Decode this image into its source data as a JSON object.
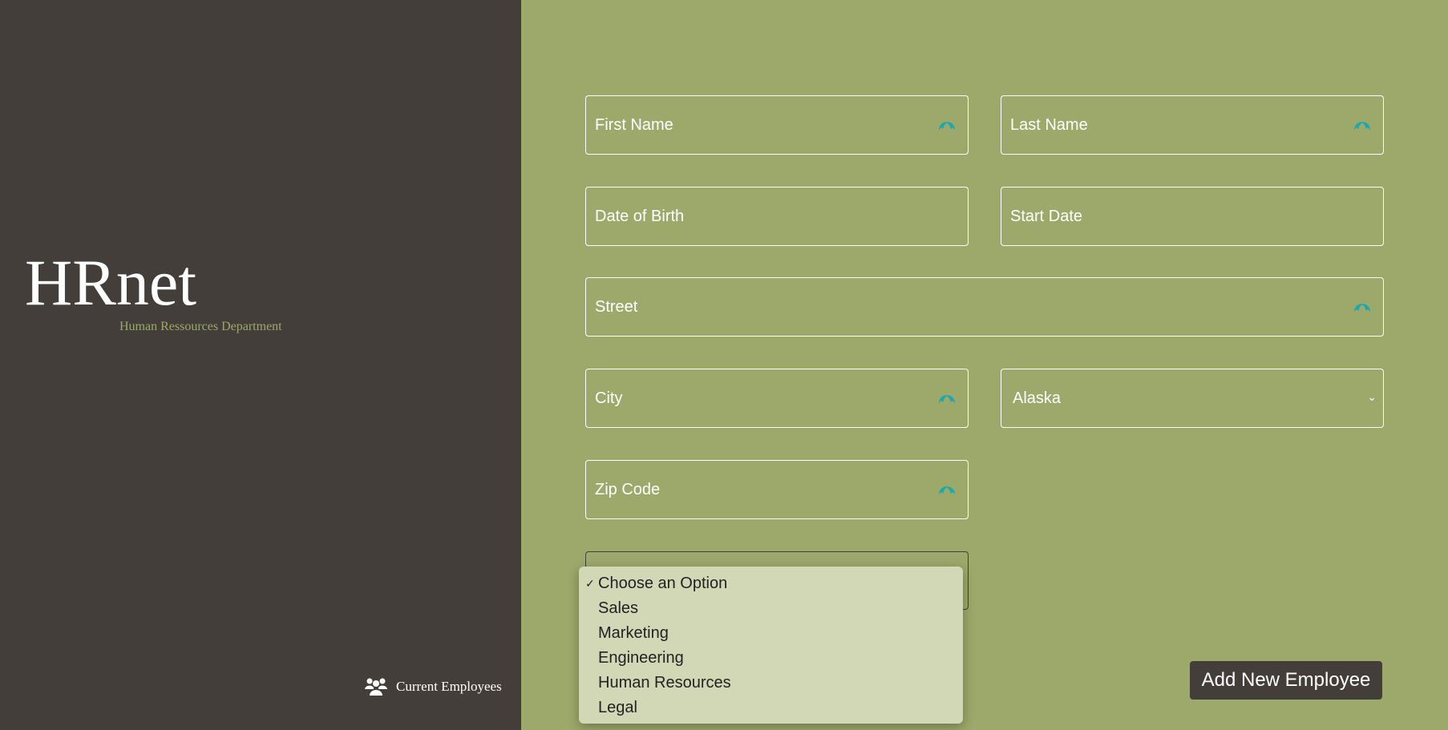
{
  "sidebar": {
    "logo": "HRnet",
    "subtitle": "Human Ressources Department",
    "current_employees": "Current Employees"
  },
  "form": {
    "first_name": "First Name",
    "last_name": "Last Name",
    "date_of_birth": "Date of Birth",
    "start_date": "Start Date",
    "street": "Street",
    "city": "City",
    "state_selected": "Alaska",
    "zip_code": "Zip Code"
  },
  "department_menu": {
    "selected": "Choose an Option",
    "options": [
      "Choose an Option",
      "Sales",
      "Marketing",
      "Engineering",
      "Human Resources",
      "Legal"
    ]
  },
  "submit_label": "Add New Employee",
  "colors": {
    "sidebar": "#433e3a",
    "main": "#9da86b",
    "accent_icon": "#1aa9ae"
  }
}
